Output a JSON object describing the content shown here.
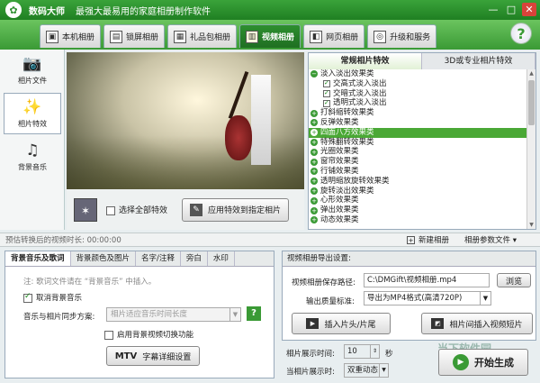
{
  "app": {
    "name": "数码大师",
    "slogan": "最强大最易用的家庭相册制作软件",
    "min": "—",
    "max": "□",
    "close": "✕"
  },
  "tabs": [
    {
      "label": "本机相册",
      "icon": "computer-icon"
    },
    {
      "label": "锁屏相册",
      "icon": "lock-icon"
    },
    {
      "label": "礼品包相册",
      "icon": "gift-icon"
    },
    {
      "label": "视频相册",
      "icon": "film-icon",
      "active": true
    },
    {
      "label": "网页相册",
      "icon": "web-icon"
    },
    {
      "label": "升级和服务",
      "icon": "upgrade-icon"
    }
  ],
  "help": "?",
  "leftnav": [
    {
      "label": "相片文件",
      "glyph": "📷"
    },
    {
      "label": "相片特效",
      "glyph": "✨",
      "active": true
    },
    {
      "label": "背景音乐",
      "glyph": "♫"
    }
  ],
  "preview": {
    "select_all": "选择全部特效",
    "apply_button": "应用特效到指定相片"
  },
  "effects": {
    "tabs": [
      "常规相片特效",
      "3D或专业相片特效"
    ],
    "items": [
      {
        "label": "淡入淡出效果类",
        "kind": "group-open"
      },
      {
        "label": "交高式淡入淡出",
        "kind": "child"
      },
      {
        "label": "交暗式淡入淡出",
        "kind": "child"
      },
      {
        "label": "透明式淡入淡出",
        "kind": "child"
      },
      {
        "label": "打斜缩转效果类",
        "kind": "group"
      },
      {
        "label": "反弹效果类",
        "kind": "group"
      },
      {
        "label": "四面八方效果类",
        "kind": "group",
        "selected": true
      },
      {
        "label": "特殊翻转效果类",
        "kind": "group"
      },
      {
        "label": "光圈效果类",
        "kind": "group"
      },
      {
        "label": "窗帘效果类",
        "kind": "group"
      },
      {
        "label": "行铺效果类",
        "kind": "group"
      },
      {
        "label": "透明缩放旋转效果类",
        "kind": "group"
      },
      {
        "label": "旋转淡出效果类",
        "kind": "group"
      },
      {
        "label": "心形效果类",
        "kind": "group"
      },
      {
        "label": "弹出效果类",
        "kind": "group"
      },
      {
        "label": "动态效果类",
        "kind": "group"
      }
    ]
  },
  "status": {
    "estimate": "预估转换后的视频时长: 00:00:00",
    "new_album": "新建相册",
    "param_file": "相册参数文件 ▾"
  },
  "bg": {
    "tabs": [
      "背景音乐及歌词",
      "背景颜色及图片",
      "名字/注释",
      "旁白",
      "水印"
    ],
    "note": "注: 歌词文件请在 “背景音乐” 中插入。",
    "cancel_music": "取消背景音乐",
    "sync_label": "音乐与相片同步方案:",
    "sync_value": "相片适应音乐时间长度",
    "switch_label": "启用背景视频切换功能",
    "mtv_label": "MTV",
    "mtv_button": "字幕详细设置"
  },
  "export": {
    "title": "视频相册导出设置:",
    "path_label": "视频相册保存路径:",
    "path_value": "C:\\DMGift\\视频相册.mp4",
    "browse": "浏览",
    "quality_label": "输出质量标准:",
    "quality_value": "导出为MP4格式(高清720P)",
    "insert_clip": "插入片头/片尾",
    "insert_video": "相片间插入视频短片",
    "time_label": "相片展示时间:",
    "time_value": "10",
    "time_unit": "秒",
    "trans_label": "当相片展示时:",
    "trans_value": "双重动态",
    "start": "开始生成"
  },
  "watermark": "当下软件园"
}
